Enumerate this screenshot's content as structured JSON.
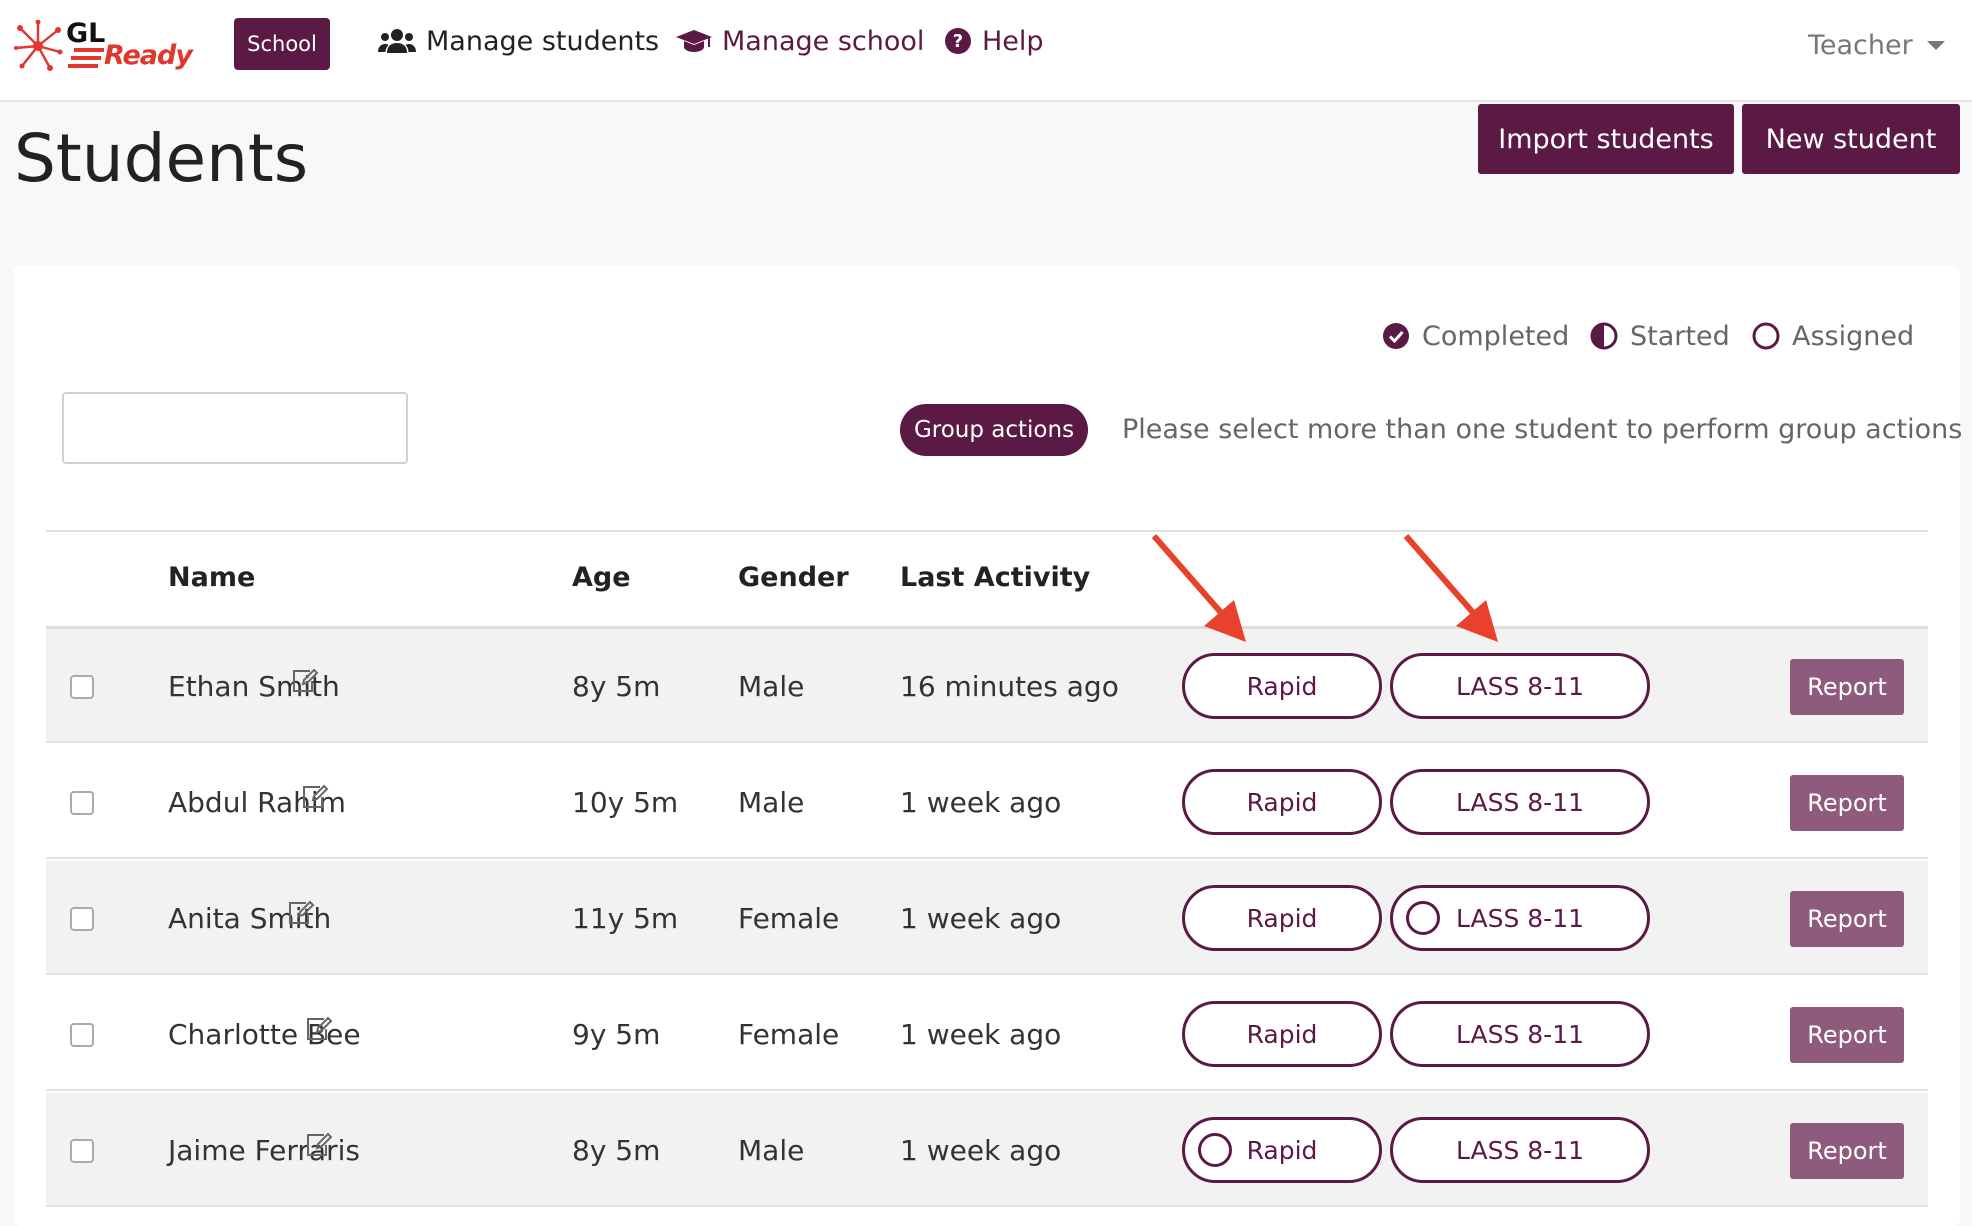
{
  "nav": {
    "logo_primary": "GL",
    "logo_secondary": "Ready",
    "school_badge": "School",
    "manage_students": "Manage students",
    "manage_school": "Manage school",
    "help": "Help",
    "user_menu": "Teacher"
  },
  "page": {
    "title": "Students",
    "import_button": "Import students",
    "new_button": "New student"
  },
  "legend": {
    "completed": "Completed",
    "started": "Started",
    "assigned": "Assigned"
  },
  "toolbar": {
    "search_value": "",
    "group_actions": "Group actions",
    "group_hint": "Please select more than one student to perform group actions"
  },
  "table": {
    "headers": {
      "name": "Name",
      "age": "Age",
      "gender": "Gender",
      "last_activity": "Last Activity"
    },
    "rows": [
      {
        "name": "Ethan Smith",
        "age": "8y 5m",
        "gender": "Male",
        "last_activity": "16 minutes ago",
        "test1": "Rapid",
        "test1_status": "",
        "test2": "LASS 8-11",
        "test2_status": "",
        "report": "Report"
      },
      {
        "name": "Abdul Rahim",
        "age": "10y 5m",
        "gender": "Male",
        "last_activity": "1 week ago",
        "test1": "Rapid",
        "test1_status": "",
        "test2": "LASS 8-11",
        "test2_status": "",
        "report": "Report"
      },
      {
        "name": "Anita Smith",
        "age": "11y 5m",
        "gender": "Female",
        "last_activity": "1 week ago",
        "test1": "Rapid",
        "test1_status": "",
        "test2": "LASS 8-11",
        "test2_status": "assigned",
        "report": "Report"
      },
      {
        "name": "Charlotte Bee",
        "age": "9y 5m",
        "gender": "Female",
        "last_activity": "1 week ago",
        "test1": "Rapid",
        "test1_status": "",
        "test2": "LASS 8-11",
        "test2_status": "",
        "report": "Report"
      },
      {
        "name": "Jaime Ferraris",
        "age": "8y 5m",
        "gender": "Male",
        "last_activity": "1 week ago",
        "test1": "Rapid",
        "test1_status": "assigned",
        "test2": "LASS 8-11",
        "test2_status": "",
        "report": "Report"
      }
    ]
  },
  "icons": {
    "logo": "spark-logo-icon",
    "manage_students": "users-icon",
    "manage_school": "graduation-cap-icon",
    "help": "question-circle-icon",
    "user_caret": "caret-down-icon",
    "completed": "check-circle-icon",
    "started": "half-circle-icon",
    "assigned": "empty-circle-icon",
    "edit": "edit-icon",
    "annotation": "red-arrow-icon"
  },
  "colors": {
    "brand": "#5b1a43",
    "report_button": "#8e5b7d",
    "logo_red": "#e0362c",
    "annotation_arrow": "#e8412c"
  }
}
